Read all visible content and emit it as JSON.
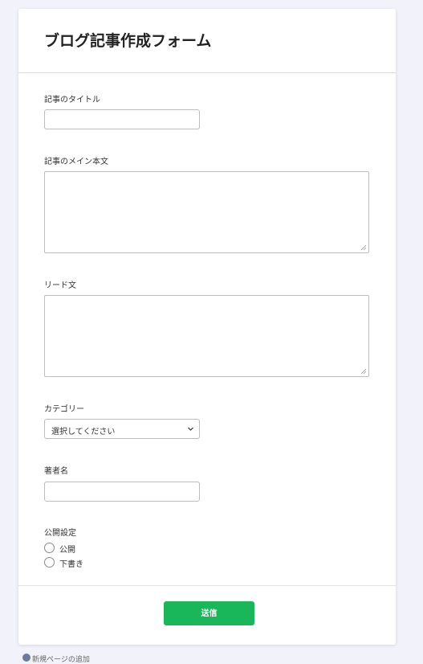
{
  "form": {
    "title": "ブログ記事作成フォーム",
    "fields": {
      "title": {
        "label": "記事のタイトル",
        "value": ""
      },
      "main_body": {
        "label": "記事のメイン本文",
        "value": ""
      },
      "lead": {
        "label": "リード文",
        "value": ""
      },
      "category": {
        "label": "カテゴリー",
        "selected": "選択してください"
      },
      "author": {
        "label": "著者名",
        "value": ""
      },
      "publish": {
        "label": "公開設定",
        "options": [
          "公開",
          "下書き"
        ]
      }
    },
    "submit_label": "送信"
  },
  "footer_link": {
    "label": "新規ページの追加"
  },
  "colors": {
    "page_background": "#f2f2fb",
    "submit_button": "#1ab75a"
  },
  "icons": {
    "select_indicator": "chevron-down-icon",
    "footer_link": "plus-circle-icon"
  }
}
